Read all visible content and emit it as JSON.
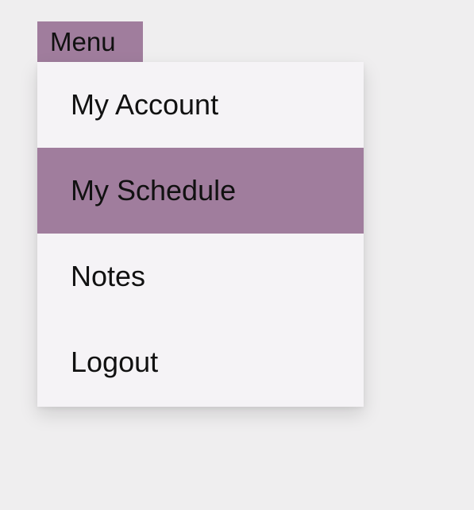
{
  "menu": {
    "button_label": "Menu",
    "items": [
      {
        "label": "My Account"
      },
      {
        "label": "My Schedule",
        "highlighted": true
      },
      {
        "label": "Notes"
      },
      {
        "label": "Logout"
      }
    ]
  },
  "colors": {
    "accent": "#a07d9d",
    "dropdown_background": "#f5f3f6",
    "page_background": "#efeeef",
    "text": "#111111"
  }
}
